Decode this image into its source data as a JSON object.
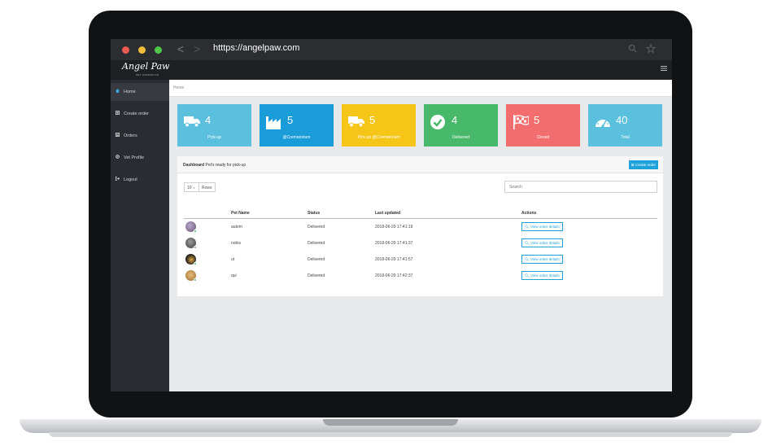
{
  "browser": {
    "url": "htttps://angelpaw.com",
    "back_icon": "<",
    "forward_icon": ">"
  },
  "app": {
    "logo": "Angel Paw",
    "logo_sub": "PET CREMATION",
    "menu_icon": "hamburger-icon"
  },
  "sidebar": {
    "items": [
      {
        "label": "Home",
        "icon": "home-icon",
        "active": true
      },
      {
        "label": "Create order",
        "icon": "plus-square-icon",
        "active": false
      },
      {
        "label": "Orders",
        "icon": "list-icon",
        "active": false
      },
      {
        "label": "Vet Profile",
        "icon": "gear-icon",
        "active": false
      },
      {
        "label": "Logout",
        "icon": "logout-icon",
        "active": false
      }
    ]
  },
  "breadcrumb": "Home",
  "stats": [
    {
      "value": "4",
      "label": "Pick-up",
      "icon": "truck-icon",
      "color": "#5bc0de"
    },
    {
      "value": "5",
      "label": "@Crematorium",
      "icon": "factory-icon",
      "color": "#1a9cd8"
    },
    {
      "value": "5",
      "label": "Pick-up @Crematorium",
      "icon": "truck-icon",
      "color": "#f5c518"
    },
    {
      "value": "4",
      "label": "Delivered",
      "icon": "check-circle-icon",
      "color": "#48b86a"
    },
    {
      "value": "5",
      "label": "Closed",
      "icon": "flag-checkered-icon",
      "color": "#f26d6d"
    },
    {
      "value": "40",
      "label": "Total",
      "icon": "dashboard-gauge-icon",
      "color": "#5bc0de"
    }
  ],
  "panel": {
    "title": "Dashboard",
    "subtitle": "Pet's ready for pick-up",
    "create_button": "Create order",
    "rows_value": "10",
    "rows_label": "Rows",
    "search_placeholder": "Search"
  },
  "table": {
    "headers": [
      "Pet Name",
      "Status",
      "Last updated",
      "Actions"
    ],
    "rows": [
      {
        "name": "autem",
        "status": "Delivered",
        "updated": "2018-06-29 17:41:19",
        "action": "View order details"
      },
      {
        "name": "nobis",
        "status": "Delivered",
        "updated": "2018-06-29 17:41:37",
        "action": "View order details"
      },
      {
        "name": "ut",
        "status": "Delivered",
        "updated": "2018-06-29 17:41:57",
        "action": "View order details"
      },
      {
        "name": "qui",
        "status": "Delivered",
        "updated": "2018-06-29 17:42:37",
        "action": "View order details"
      }
    ]
  }
}
